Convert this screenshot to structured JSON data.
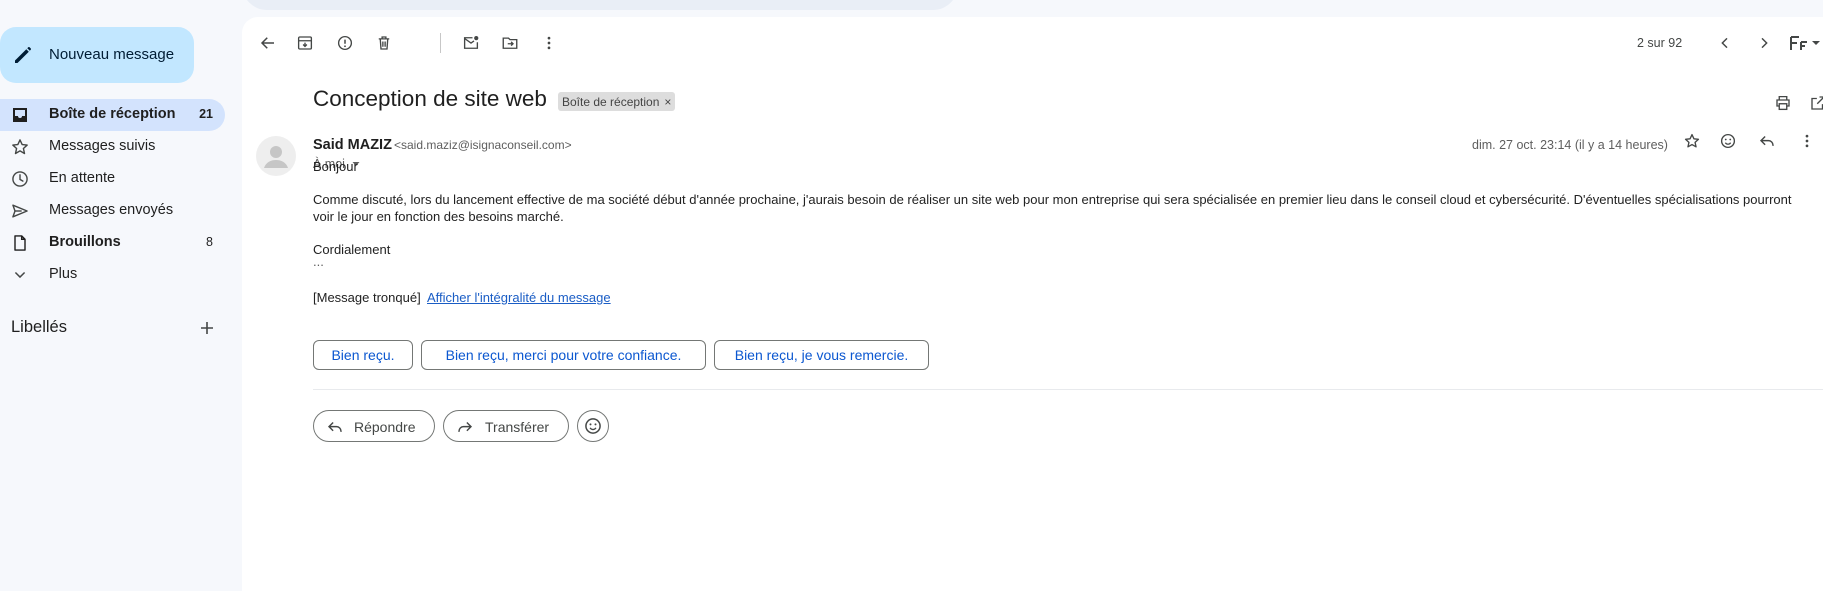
{
  "compose": {
    "label": "Nouveau message",
    "icon": "pencil-icon"
  },
  "sidebar": {
    "items": [
      {
        "label": "Boîte de réception",
        "count": "21",
        "icon": "inbox-icon",
        "active": true,
        "bold": true
      },
      {
        "label": "Messages suivis",
        "count": "",
        "icon": "star-icon"
      },
      {
        "label": "En attente",
        "count": "",
        "icon": "clock-icon"
      },
      {
        "label": "Messages envoyés",
        "count": "",
        "icon": "send-icon"
      },
      {
        "label": "Brouillons",
        "count": "8",
        "icon": "draft-icon",
        "bold": true
      },
      {
        "label": "Plus",
        "count": "",
        "icon": "chevron-down-icon"
      }
    ],
    "labels_title": "Libellés"
  },
  "toolbar": {
    "pager": "2 sur 92",
    "icons": [
      "back-arrow-icon",
      "archive-icon",
      "report-spam-icon",
      "delete-icon",
      "mark-unread-icon",
      "move-to-icon",
      "more-vert-icon",
      "prev-icon",
      "next-icon",
      "input-tools-icon"
    ]
  },
  "message": {
    "subject": "Conception de site web",
    "label_chip": "Boîte de réception",
    "label_chip_close": "×",
    "sender_name": "Said MAZIZ",
    "sender_email": "<said.maziz@isignaconseil.com>",
    "to": "À moi",
    "date": "dim. 27 oct. 23:14 (il y a 14 heures)",
    "greeting": "Bonjour",
    "body_line1": "Comme discuté, lors du lancement effective de ma société début d'année prochaine, j'aurais besoin de réaliser un site web pour mon entreprise qui sera spécialisée en premier lieu dans le conseil cloud et cybersécurité. D'éventuelles spécialisations pourront",
    "body_line2": "voir le jour en fonction des besoins marché.",
    "signoff": "Cordialement",
    "ellipsis": "...",
    "truncated": "[Message tronqué]",
    "show_full": "Afficher l'intégralité du message"
  },
  "smart_replies": [
    "Bien reçu.",
    "Bien reçu, merci pour votre confiance.",
    "Bien reçu, je vous remercie."
  ],
  "actions": {
    "reply": "Répondre",
    "forward": "Transférer"
  },
  "colors": {
    "accent": "#0b57d0",
    "compose_bg": "#c2e7ff",
    "active_nav": "#d3e3fd",
    "page_bg": "#f6f8fc"
  }
}
